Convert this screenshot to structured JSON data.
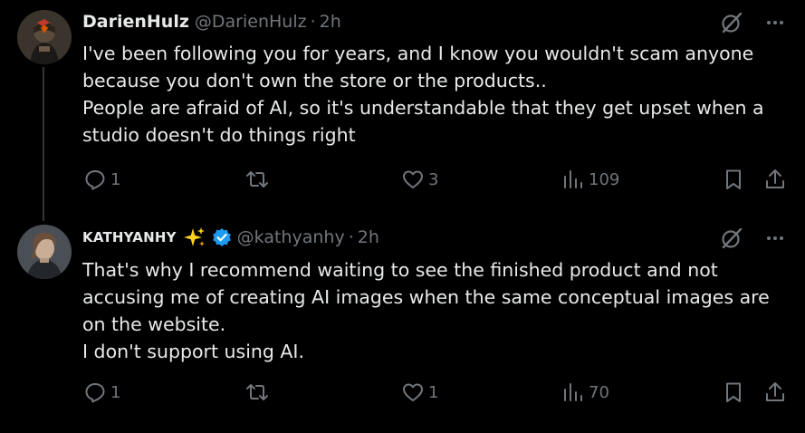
{
  "colors": {
    "background": "#000000",
    "text": "#e7e9ea",
    "muted": "#71767b",
    "thread_line": "#333639",
    "verified": "#1d9bf0",
    "sparkle": "#ffd21f"
  },
  "tweets": [
    {
      "display_name": "DarienHulz",
      "handle": "@DarienHulz",
      "separator": "·",
      "time": "2h",
      "text_lines": [
        "I've been following you for years, and I know you wouldn't scam anyone",
        "because you don't own the store or the products..",
        "People are afraid of AI, so it's understandable that they get upset when a",
        "studio doesn't do things right"
      ],
      "replies": "1",
      "reposts": "",
      "likes": "3",
      "views": "109",
      "icons": [
        "grok-icon",
        "more-icon",
        "reply-icon",
        "repost-icon",
        "like-icon",
        "views-icon",
        "bookmark-icon",
        "share-icon"
      ]
    },
    {
      "display_name": "KATHYANHY",
      "handle": "@kathyanhy",
      "separator": "·",
      "time": "2h",
      "text_lines": [
        "That's why I recommend waiting to see the finished product and not",
        "accusing me of creating AI images when the same conceptual images are",
        "on the website.",
        "I don't support using AI."
      ],
      "replies": "1",
      "reposts": "",
      "likes": "1",
      "views": "70",
      "icons": [
        "sparkles-icon",
        "verified-badge-icon",
        "grok-icon",
        "more-icon",
        "reply-icon",
        "repost-icon",
        "like-icon",
        "views-icon",
        "bookmark-icon",
        "share-icon"
      ]
    }
  ]
}
